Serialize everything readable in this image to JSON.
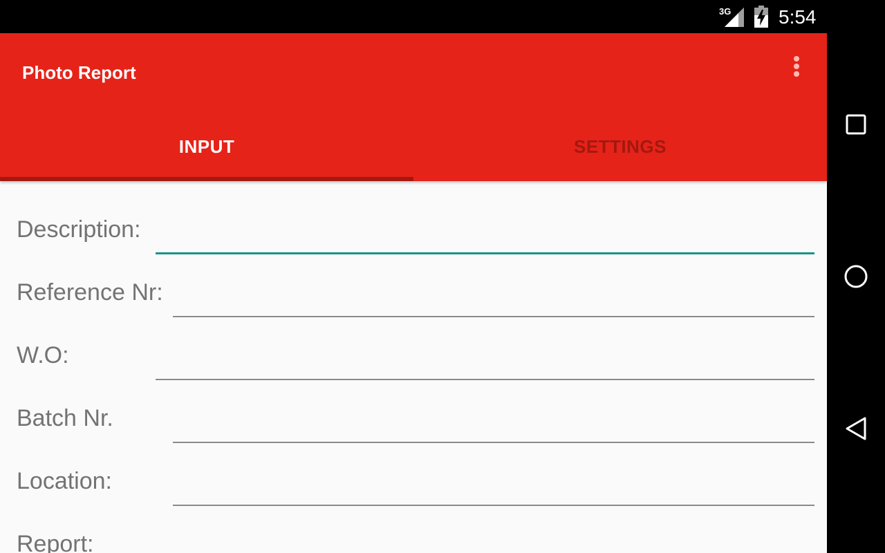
{
  "status_bar": {
    "network_label": "3G",
    "time": "5:54",
    "icons": [
      "signal-icon",
      "battery-charging-icon"
    ]
  },
  "app_bar": {
    "title": "Photo Report",
    "overflow_icon": "more-vert-icon",
    "color": "#e62319"
  },
  "tabs": [
    {
      "label": "INPUT",
      "selected": true
    },
    {
      "label": "SETTINGS",
      "selected": false
    }
  ],
  "form": {
    "fields": [
      {
        "label": "Description:",
        "value": "",
        "focused": true
      },
      {
        "label": "Reference Nr:",
        "value": ""
      },
      {
        "label": "W.O:",
        "value": ""
      },
      {
        "label": "Batch Nr.",
        "value": ""
      },
      {
        "label": "Location:",
        "value": ""
      },
      {
        "label": "Report:",
        "value": ""
      }
    ]
  },
  "nav_bar": {
    "icons": [
      "recents-icon",
      "home-icon",
      "back-icon"
    ]
  },
  "colors": {
    "accent": "#e62319",
    "tab_indicator": "#a31810",
    "focus_underline": "#14958a"
  }
}
